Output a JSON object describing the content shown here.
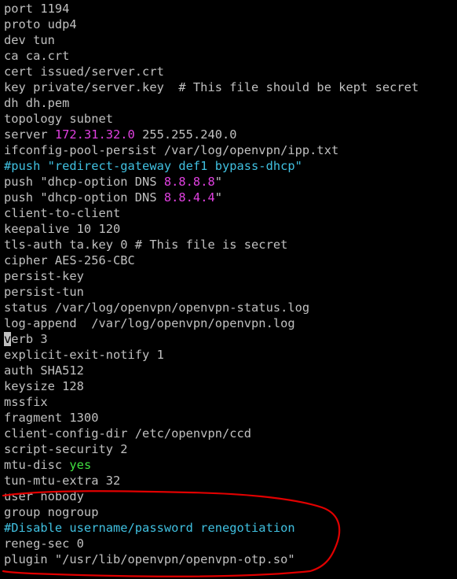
{
  "theme": {
    "background": "#000000",
    "text": "#c0c0c0",
    "number": "#e040e0",
    "comment": "#40c0e0",
    "keyword": "#40e040",
    "cursor": "#c0c0c0",
    "outline": "#e00000"
  },
  "lines": [
    [
      {
        "t": "port 1194",
        "c": "text"
      }
    ],
    [
      {
        "t": "proto udp4",
        "c": "text"
      }
    ],
    [
      {
        "t": "dev tun",
        "c": "text"
      }
    ],
    [
      {
        "t": "ca ca.crt",
        "c": "text"
      }
    ],
    [
      {
        "t": "cert issued/server.crt",
        "c": "text"
      }
    ],
    [
      {
        "t": "key private/server.key  # This file should be kept secret",
        "c": "text"
      }
    ],
    [
      {
        "t": "dh dh.pem",
        "c": "text"
      }
    ],
    [
      {
        "t": "topology subnet",
        "c": "text"
      }
    ],
    [
      {
        "t": "server ",
        "c": "text"
      },
      {
        "t": "172.31.32.0",
        "c": "number"
      },
      {
        "t": " 255.255.240.0",
        "c": "text"
      }
    ],
    [
      {
        "t": "ifconfig-pool-persist /var/log/openvpn/ipp.txt",
        "c": "text"
      }
    ],
    [
      {
        "t": "#push \"redirect-gateway def1 bypass-dhcp\"",
        "c": "comment"
      }
    ],
    [
      {
        "t": "push \"dhcp-option DNS ",
        "c": "text"
      },
      {
        "t": "8.8.8.8",
        "c": "number"
      },
      {
        "t": "\"",
        "c": "text"
      }
    ],
    [
      {
        "t": "push \"dhcp-option DNS ",
        "c": "text"
      },
      {
        "t": "8.8.4.4",
        "c": "number"
      },
      {
        "t": "\"",
        "c": "text"
      }
    ],
    [
      {
        "t": "client-to-client",
        "c": "text"
      }
    ],
    [
      {
        "t": "keepalive 10 120",
        "c": "text"
      }
    ],
    [
      {
        "t": "tls-auth ta.key 0 # This file is secret",
        "c": "text"
      }
    ],
    [
      {
        "t": "cipher AES-256-CBC",
        "c": "text"
      }
    ],
    [
      {
        "t": "persist-key",
        "c": "text"
      }
    ],
    [
      {
        "t": "persist-tun",
        "c": "text"
      }
    ],
    [
      {
        "t": "status /var/log/openvpn/openvpn-status.log",
        "c": "text"
      }
    ],
    [
      {
        "t": "log-append  /var/log/openvpn/openvpn.log",
        "c": "text"
      }
    ],
    [
      {
        "t": "v",
        "c": "cursor"
      },
      {
        "t": "erb 3",
        "c": "text"
      }
    ],
    [
      {
        "t": "explicit-exit-notify 1",
        "c": "text"
      }
    ],
    [
      {
        "t": "auth SHA512",
        "c": "text"
      }
    ],
    [
      {
        "t": "keysize 128",
        "c": "text"
      }
    ],
    [
      {
        "t": "mssfix",
        "c": "text"
      }
    ],
    [
      {
        "t": "fragment 1300",
        "c": "text"
      }
    ],
    [
      {
        "t": "client-config-dir /etc/openvpn/ccd",
        "c": "text"
      }
    ],
    [
      {
        "t": "script-security 2",
        "c": "text"
      }
    ],
    [
      {
        "t": "mtu-disc ",
        "c": "text"
      },
      {
        "t": "yes",
        "c": "keyword"
      }
    ],
    [
      {
        "t": "tun-mtu-extra 32",
        "c": "text"
      }
    ],
    [
      {
        "t": "user nobody",
        "c": "text"
      }
    ],
    [
      {
        "t": "group nogroup",
        "c": "text"
      }
    ],
    [
      {
        "t": "#Disable username/password renegotiation",
        "c": "comment"
      }
    ],
    [
      {
        "t": "reneg-sec 0",
        "c": "text"
      }
    ],
    [
      {
        "t": "plugin \"/usr/lib/openvpn/openvpn-otp.so\"",
        "c": "text"
      }
    ]
  ]
}
